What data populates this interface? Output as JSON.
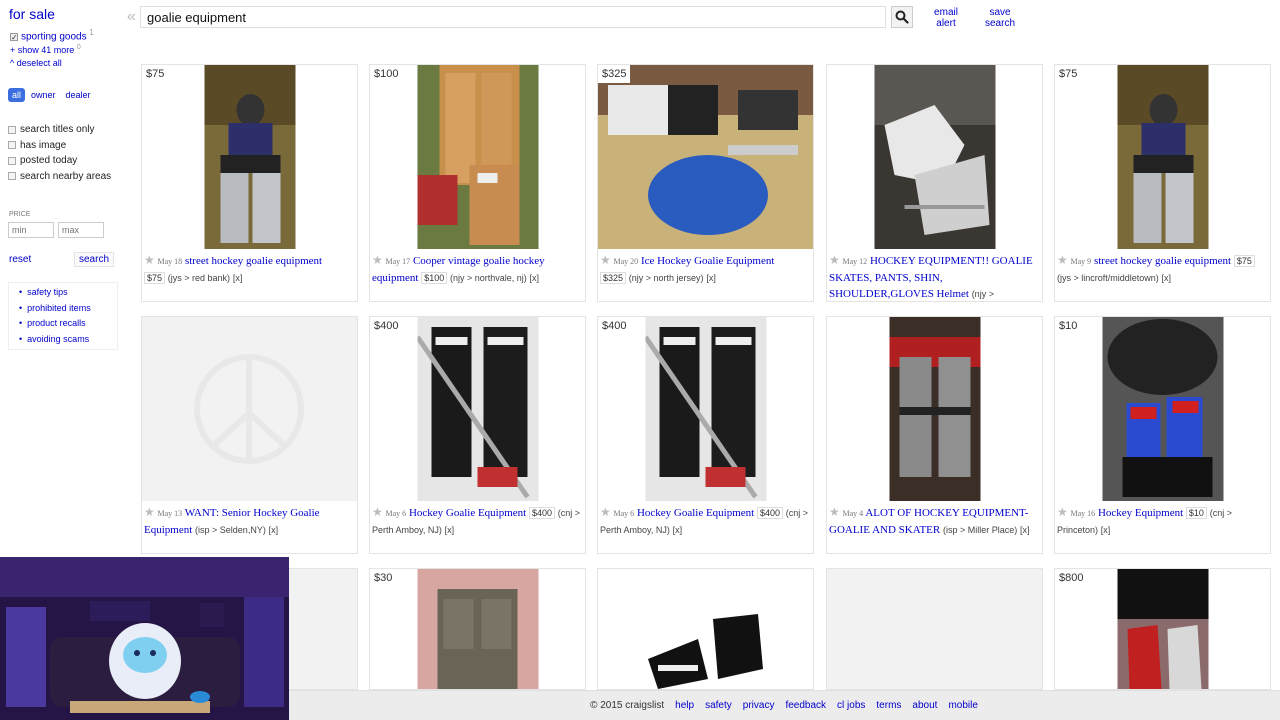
{
  "sidebar": {
    "category_title": "for sale",
    "category_checked": "sporting goods",
    "category_count": "1",
    "show_more": "+ show 41 more",
    "show_more_count": "0",
    "deselect_all": "^ deselect all",
    "seller_tabs": [
      {
        "label": "all",
        "active": true
      },
      {
        "label": "owner",
        "active": false
      },
      {
        "label": "dealer",
        "active": false
      }
    ],
    "filters": [
      "search titles only",
      "has image",
      "posted today",
      "search nearby areas"
    ],
    "price_label": "PRICE",
    "price_min_placeholder": "min",
    "price_max_placeholder": "max",
    "reset_label": "reset",
    "search_label": "search",
    "help_links": [
      "safety tips",
      "prohibited items",
      "product recalls",
      "avoiding scams"
    ]
  },
  "header": {
    "query": "goalie equipment",
    "email_alert": "email alert",
    "save_search": "save search"
  },
  "listings": [
    {
      "price": "$75",
      "date": "May 18",
      "title": "street hockey goalie equipment",
      "price_pill": "$75",
      "location": "(jys > red bank)",
      "x": "[x]"
    },
    {
      "price": "$100",
      "date": "May 17",
      "title": "Cooper vintage goalie hockey equipment",
      "price_pill": "$100",
      "location": "(njy > northvale, nj)",
      "x": "[x]"
    },
    {
      "price": "$325",
      "date": "May 20",
      "title": "Ice Hockey Goalie Equipment",
      "price_pill": "$325",
      "location": "(njy > north jersey)",
      "x": "[x]"
    },
    {
      "price": "",
      "date": "May 12",
      "title": "HOCKEY EQUIPMENT!! GOALIE SKATES, PANTS, SHIN, SHOULDER,GLOVES Helmet",
      "price_pill": "",
      "location": "(njy >",
      "x": ""
    },
    {
      "price": "$75",
      "date": "May 9",
      "title": "street hockey goalie equipment",
      "price_pill": "$75",
      "location": "(jys > lincroft/middletown)",
      "x": "[x]"
    },
    {
      "price": "",
      "date": "May 13",
      "title": "WANT: Senior Hockey Goalie Equipment",
      "price_pill": "",
      "location": "(isp > Selden,NY)",
      "x": "[x]"
    },
    {
      "price": "$400",
      "date": "May 6",
      "title": "Hockey Goalie Equipment",
      "price_pill": "$400",
      "location": "(cnj > Perth Amboy, NJ)",
      "x": "[x]"
    },
    {
      "price": "$400",
      "date": "May 6",
      "title": "Hockey Goalie Equipment",
      "price_pill": "$400",
      "location": "(cnj > Perth Amboy, NJ)",
      "x": "[x]"
    },
    {
      "price": "",
      "date": "May 4",
      "title": "ALOT OF HOCKEY EQUIPMENT- GOALIE AND SKATER",
      "price_pill": "",
      "location": "(isp > Miller Place)",
      "x": "[x]"
    },
    {
      "price": "$10",
      "date": "May 16",
      "title": "Hockey Equipment",
      "price_pill": "$10",
      "location": "(cnj > Princeton)",
      "x": "[x]"
    },
    {
      "price": "$30"
    },
    {
      "price": ""
    },
    {
      "price": ""
    },
    {
      "price": "$800"
    }
  ],
  "footer": {
    "copyright": "© 2015 craigslist",
    "links": [
      "help",
      "safety",
      "privacy",
      "feedback",
      "cl jobs",
      "terms",
      "about",
      "mobile"
    ]
  }
}
